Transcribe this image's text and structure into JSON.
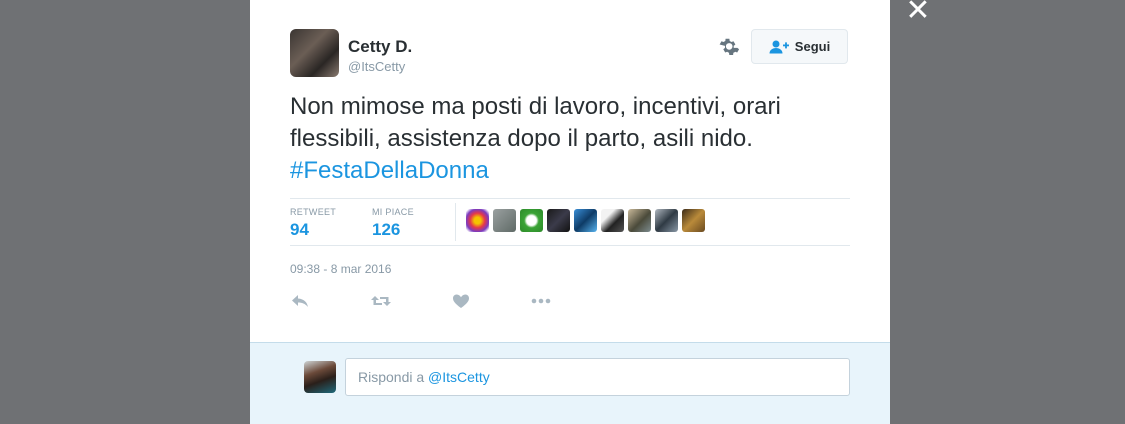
{
  "overlay": {
    "close_icon": "close-icon"
  },
  "tweet": {
    "user": {
      "name": "Cetty D.",
      "handle": "@ItsCetty"
    },
    "follow_label": "Segui",
    "text": "Non mimose ma posti di lavoro, incentivi, orari flessibili, assistenza dopo il parto, asili nido.",
    "hashtag": "#FestaDellaDonna",
    "stats": {
      "retweet_label": "RETWEET",
      "retweet_count": "94",
      "likes_label": "MI PIACE",
      "likes_count": "126"
    },
    "likers_count": 10,
    "timestamp": "09:38 - 8 mar 2016",
    "actions": [
      "reply-icon",
      "retweet-icon",
      "like-icon",
      "more-icon"
    ]
  },
  "reply": {
    "prefix": "Rispondi a ",
    "mention": "@ItsCetty"
  },
  "colors": {
    "accent": "#1b95e0",
    "text": "#292f33",
    "muted": "#8899a6",
    "backdrop": "#6f7174",
    "reply_bg": "#e8f4fb"
  }
}
